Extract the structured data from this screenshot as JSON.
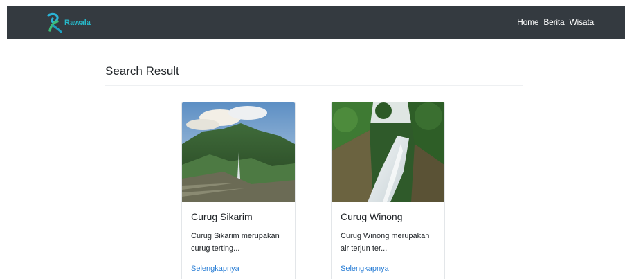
{
  "navbar": {
    "brand": "Rawala",
    "links": [
      "Home",
      "Berita",
      "Wisata"
    ],
    "background": "#343a40"
  },
  "main": {
    "heading": "Search Result",
    "cards": [
      {
        "title": "Curug Sikarim",
        "text": "Curug Sikarim merupakan curug terting...",
        "link": "Selengkapnya"
      },
      {
        "title": "Curug Winong",
        "text": "Curug Winong merupakan air terjun ter...",
        "link": "Selengkapnya"
      }
    ]
  },
  "colors": {
    "link": "#2b7fd6",
    "brand": "#27b8c9"
  }
}
